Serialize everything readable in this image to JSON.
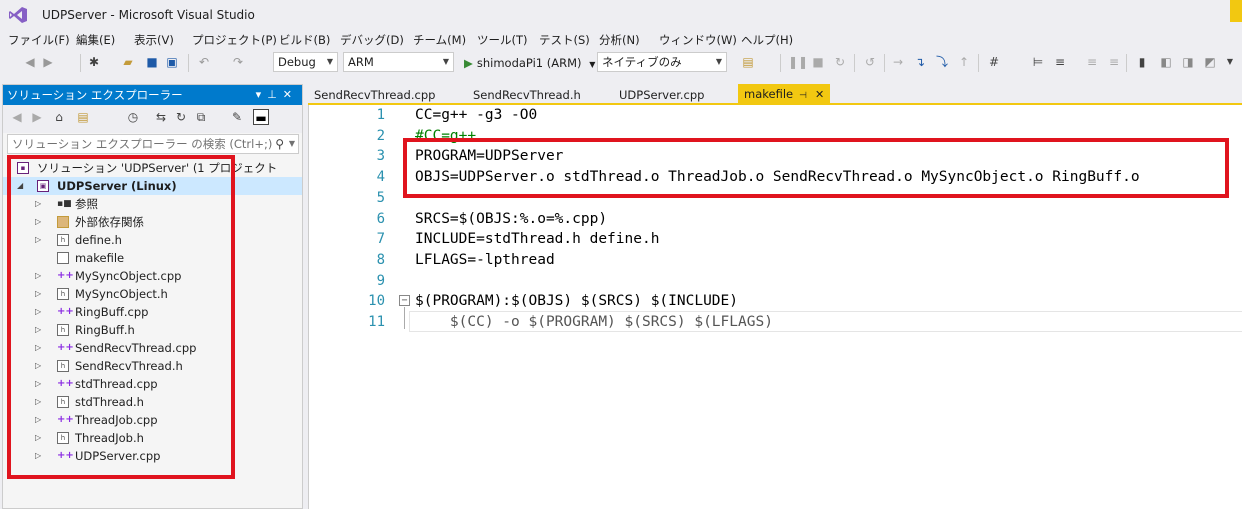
{
  "window": {
    "title": "UDPServer - Microsoft Visual Studio",
    "accent_color": "#f2c811",
    "logo_icon": "visual-studio-icon"
  },
  "menu": [
    "ファイル(F)",
    "編集(E)",
    "表示(V)",
    "プロジェクト(P)",
    "ビルド(B)",
    "デバッグ(D)",
    "チーム(M)",
    "ツール(T)",
    "テスト(S)",
    "分析(N)",
    "ウィンドウ(W)",
    "ヘルプ(H)"
  ],
  "toolbar": {
    "configuration": "Debug",
    "platform": "ARM",
    "run_target": "shimodaPi1 (ARM)",
    "debugger_type": "ネイティブのみ"
  },
  "solution_explorer": {
    "title": "ソリューション エクスプローラー",
    "search_placeholder": "ソリューション エクスプローラー の検索 (Ctrl+;)",
    "solution_label": "ソリューション 'UDPServer' (1 プロジェクト",
    "project_label": "UDPServer (Linux)",
    "items": [
      {
        "label": "参照",
        "icon": "references-icon",
        "expandable": true
      },
      {
        "label": "外部依存関係",
        "icon": "external-deps-icon",
        "expandable": true
      },
      {
        "label": "define.h",
        "icon": "header-file-icon",
        "expandable": true
      },
      {
        "label": "makefile",
        "icon": "file-icon",
        "expandable": false
      },
      {
        "label": "MySyncObject.cpp",
        "icon": "cpp-file-icon",
        "expandable": true
      },
      {
        "label": "MySyncObject.h",
        "icon": "header-file-icon",
        "expandable": true
      },
      {
        "label": "RingBuff.cpp",
        "icon": "cpp-file-icon",
        "expandable": true
      },
      {
        "label": "RingBuff.h",
        "icon": "header-file-icon",
        "expandable": true
      },
      {
        "label": "SendRecvThread.cpp",
        "icon": "cpp-file-icon",
        "expandable": true
      },
      {
        "label": "SendRecvThread.h",
        "icon": "header-file-icon",
        "expandable": true
      },
      {
        "label": "stdThread.cpp",
        "icon": "cpp-file-icon",
        "expandable": true
      },
      {
        "label": "stdThread.h",
        "icon": "header-file-icon",
        "expandable": true
      },
      {
        "label": "ThreadJob.cpp",
        "icon": "cpp-file-icon",
        "expandable": true
      },
      {
        "label": "ThreadJob.h",
        "icon": "header-file-icon",
        "expandable": true
      },
      {
        "label": "UDPServer.cpp",
        "icon": "cpp-file-icon",
        "expandable": true
      }
    ]
  },
  "editor": {
    "tabs": [
      {
        "label": "SendRecvThread.cpp",
        "active": false
      },
      {
        "label": "SendRecvThread.h",
        "active": false
      },
      {
        "label": "UDPServer.cpp",
        "active": false
      },
      {
        "label": "makefile",
        "active": true
      }
    ],
    "lines": [
      {
        "no": "1",
        "text": "CC=g++ -g3 -O0",
        "style": "normal"
      },
      {
        "no": "2",
        "text": "#CC=g++",
        "style": "comment"
      },
      {
        "no": "3",
        "text": "PROGRAM=UDPServer",
        "style": "normal"
      },
      {
        "no": "4",
        "text": "OBJS=UDPServer.o stdThread.o ThreadJob.o SendRecvThread.o MySyncObject.o RingBuff.o",
        "style": "normal"
      },
      {
        "no": "5",
        "text": "",
        "style": "normal"
      },
      {
        "no": "6",
        "text": "SRCS=$(OBJS:%.o=%.cpp)",
        "style": "normal"
      },
      {
        "no": "7",
        "text": "INCLUDE=stdThread.h define.h",
        "style": "normal"
      },
      {
        "no": "8",
        "text": "LFLAGS=-lpthread",
        "style": "normal"
      },
      {
        "no": "9",
        "text": "",
        "style": "normal"
      },
      {
        "no": "10",
        "text": "$(PROGRAM):$(OBJS) $(SRCS) $(INCLUDE)",
        "style": "normal"
      },
      {
        "no": "11",
        "text": "    $(CC) -o $(PROGRAM) $(SRCS) $(LFLAGS)",
        "style": "dim"
      }
    ]
  },
  "highlight_color": "#e0141e"
}
